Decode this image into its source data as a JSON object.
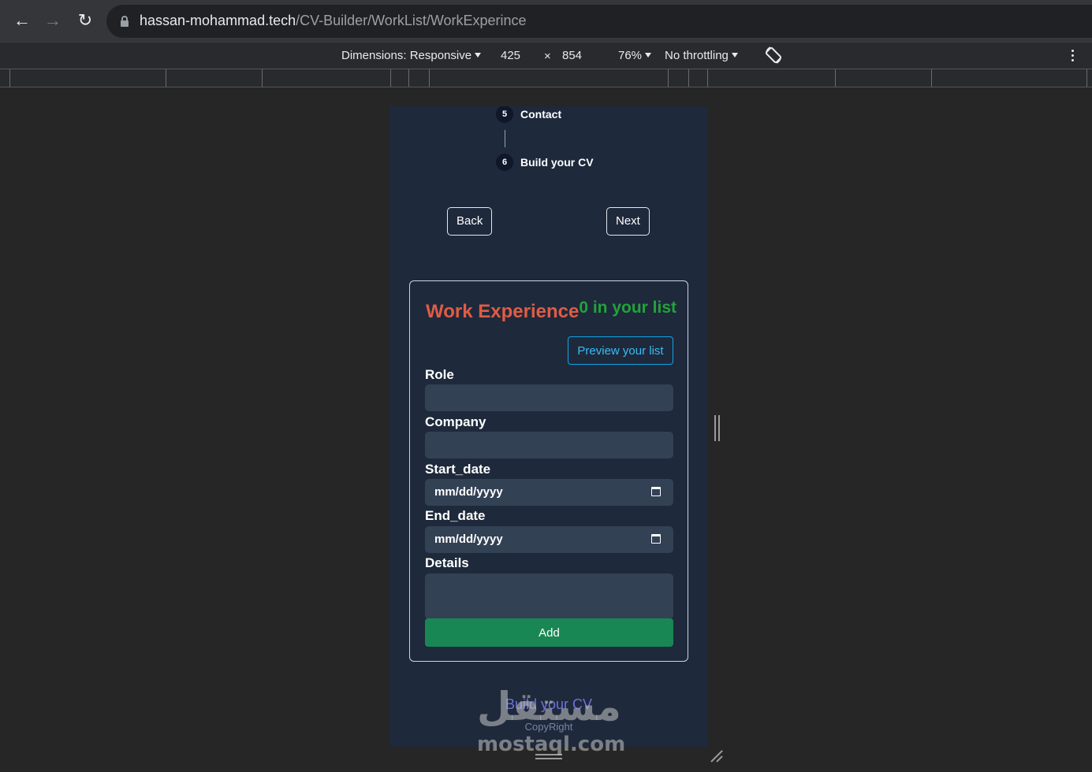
{
  "browser": {
    "url_host": "hassan-mohammad.tech",
    "url_path": "/CV-Builder/WorkList/WorkExperince"
  },
  "devtools": {
    "dimensions_label": "Dimensions: Responsive",
    "width": "425",
    "times": "×",
    "height": "854",
    "zoom": "76%",
    "throttling": "No throttling"
  },
  "steps": [
    {
      "number": "5",
      "label": "Contact"
    },
    {
      "number": "6",
      "label": "Build your CV"
    }
  ],
  "nav": {
    "back_label": "Back",
    "next_label": "Next"
  },
  "card": {
    "title": "Work Experience",
    "count_text": "0 in your list",
    "preview_label": "Preview your list",
    "fields": {
      "role": "Role",
      "company": "Company",
      "start_date": "Start_date",
      "end_date": "End_date",
      "details": "Details"
    },
    "date_placeholder": "mm/dd/yyyy",
    "add_label": "Add"
  },
  "footer": {
    "title": "Build your CV",
    "copyright": "CopyRight"
  },
  "watermark": {
    "arabic": "مستقل",
    "latin": "mostaql.com"
  },
  "colors": {
    "page_bg": "#1e293b",
    "title": "#e05c44",
    "count": "#22a33a",
    "preview": "#38bdf8",
    "add": "#198754",
    "input": "#334155"
  }
}
